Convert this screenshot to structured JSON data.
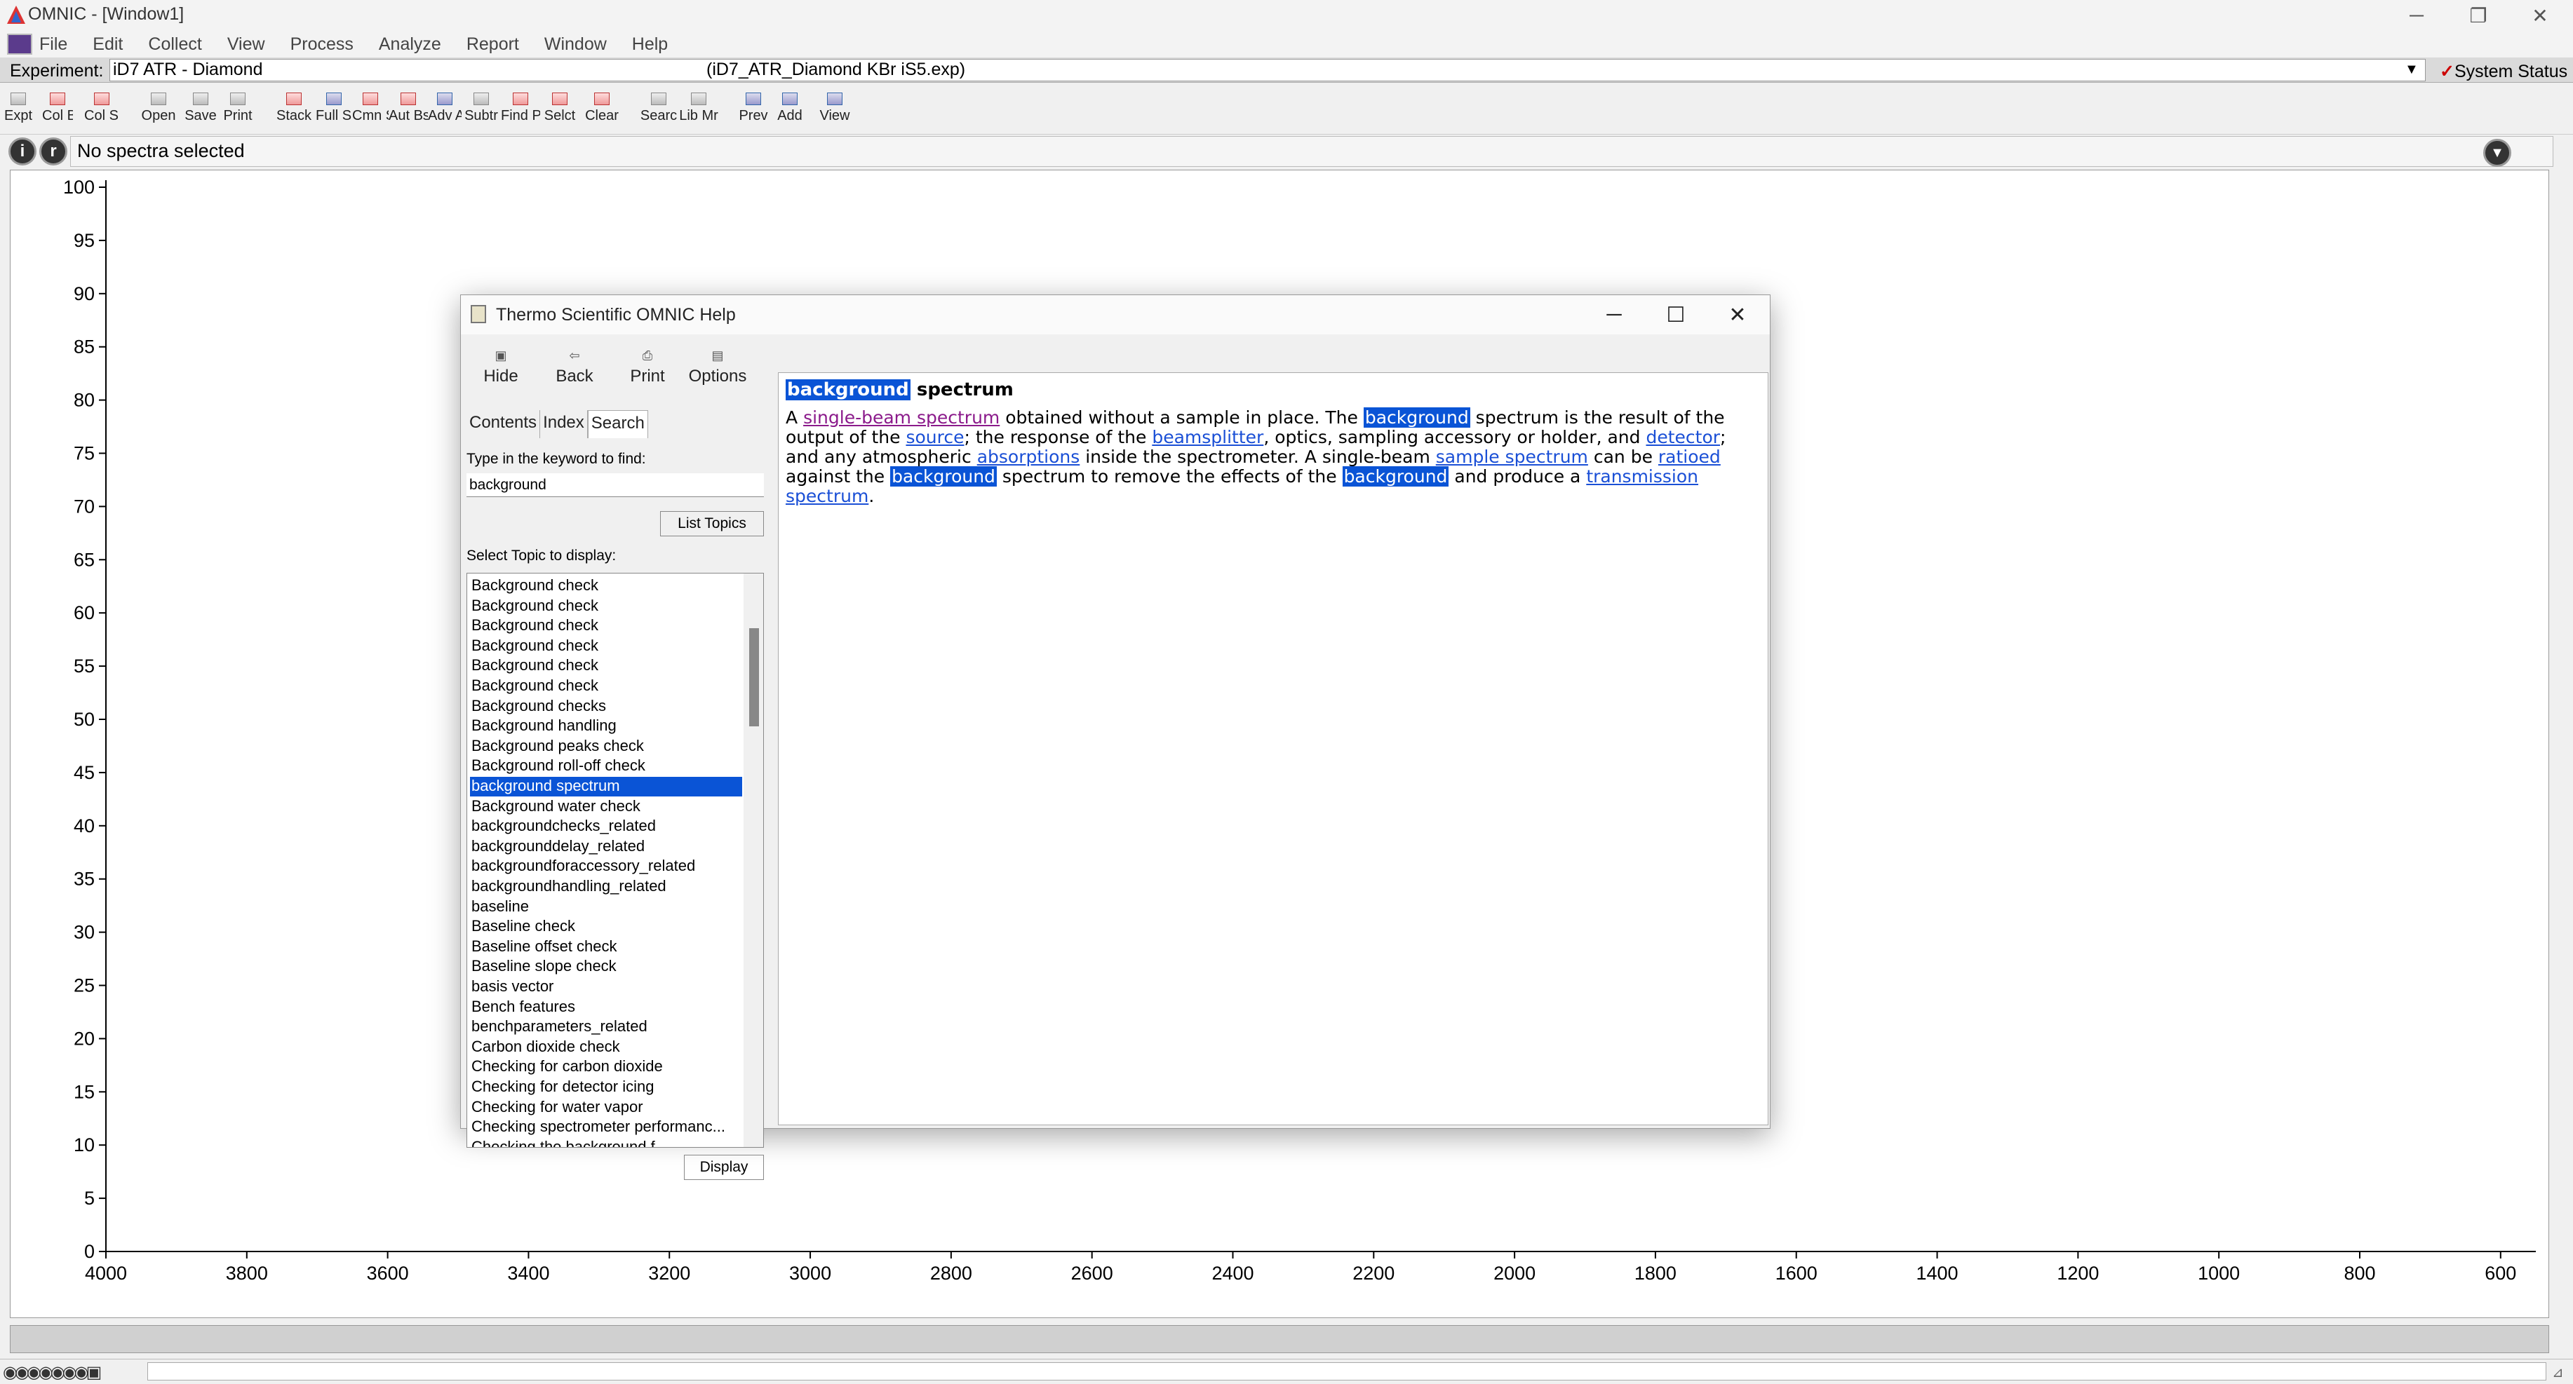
{
  "app": {
    "title": "OMNIC - [Window1]"
  },
  "menu": [
    "File",
    "Edit",
    "Collect",
    "View",
    "Process",
    "Analyze",
    "Report",
    "Window",
    "Help"
  ],
  "experiment": {
    "label": "Experiment:",
    "value": "iD7 ATR - Diamond",
    "file": "(iD7_ATR_Diamond KBr iS5.exp)",
    "system_status": "System Status"
  },
  "toolbar": [
    {
      "label": "Expt S"
    },
    {
      "label": "Col Bk"
    },
    {
      "label": "Col Sm"
    },
    {
      "label": "Open"
    },
    {
      "label": "Save"
    },
    {
      "label": "Print"
    },
    {
      "label": "Stack"
    },
    {
      "label": "Full Sc"
    },
    {
      "label": "Cmn S"
    },
    {
      "label": "Aut Bs"
    },
    {
      "label": "Adv A"
    },
    {
      "label": "Subtr"
    },
    {
      "label": "Find P"
    },
    {
      "label": "Selct"
    },
    {
      "label": "Clear"
    },
    {
      "label": "Searc"
    },
    {
      "label": "Lib Mr"
    },
    {
      "label": "Prev"
    },
    {
      "label": "Add"
    },
    {
      "label": "View"
    }
  ],
  "info": {
    "text": "No spectra selected",
    "btn_i": "i",
    "btn_r": "r"
  },
  "chart_data": {
    "type": "line",
    "x_ticks": [
      4000,
      3800,
      3600,
      3400,
      3200,
      3000,
      2800,
      2600,
      2400,
      2200,
      2000,
      1800,
      1600,
      1400,
      1200,
      1000,
      800,
      600
    ],
    "y_ticks": [
      100,
      95,
      90,
      85,
      80,
      75,
      70,
      65,
      60,
      55,
      50,
      45,
      40,
      35,
      30,
      25,
      20,
      15,
      10,
      5,
      0
    ],
    "xlim": [
      4000,
      550
    ],
    "ylim": [
      0,
      100
    ],
    "series": []
  },
  "help": {
    "title": "Thermo Scientific OMNIC Help",
    "toolbar": [
      "Hide",
      "Back",
      "Print",
      "Options"
    ],
    "tabs": [
      "Contents",
      "Index",
      "Search"
    ],
    "keyword_label": "Type in the keyword to find:",
    "keyword_value": "background",
    "list_topics": "List Topics",
    "select_label": "Select Topic to display:",
    "topics": [
      "Background check",
      "Background check",
      "Background check",
      "Background check",
      "Background check",
      "Background check",
      "Background checks",
      "Background handling",
      "Background peaks check",
      "Background roll-off check",
      "background spectrum",
      "Background water check",
      "backgroundchecks_related",
      "backgrounddelay_related",
      "backgroundforaccessory_related",
      "backgroundhandling_related",
      "baseline",
      "Baseline check",
      "Baseline offset check",
      "Baseline slope check",
      "basis vector",
      "Bench features",
      "benchparameters_related",
      "Carbon dioxide check",
      "Checking for carbon dioxide",
      "Checking for detector icing",
      "Checking for water vapor",
      "Checking spectrometer performanc...",
      "Checking the background f..."
    ],
    "selected_index": 10,
    "display": "Display",
    "content": {
      "heading_hl": "background",
      "heading_rest": " spectrum",
      "parts": [
        {
          "t": "A "
        },
        {
          "t": "single-beam spectrum",
          "c": "lkp"
        },
        {
          "t": " obtained without a sample in place. The "
        },
        {
          "t": "background",
          "c": "hl"
        },
        {
          "t": " spectrum is the result of the output of the "
        },
        {
          "t": "source",
          "c": "lk"
        },
        {
          "t": "; the response of the "
        },
        {
          "t": "beamsplitter",
          "c": "lk"
        },
        {
          "t": ", optics, sampling accessory or holder, and "
        },
        {
          "t": "detector",
          "c": "lk"
        },
        {
          "t": "; and any atmospheric "
        },
        {
          "t": "absorptions",
          "c": "lk"
        },
        {
          "t": " inside the spectrometer. A single-beam "
        },
        {
          "t": "sample spectrum",
          "c": "lk"
        },
        {
          "t": " can be "
        },
        {
          "t": "ratioed",
          "c": "lk"
        },
        {
          "t": " against the "
        },
        {
          "t": "background",
          "c": "hl"
        },
        {
          "t": " spectrum to remove the effects of the "
        },
        {
          "t": "background",
          "c": "hl"
        },
        {
          "t": " and produce a "
        },
        {
          "t": "transmission spectrum",
          "c": "lk"
        },
        {
          "t": "."
        }
      ]
    }
  }
}
